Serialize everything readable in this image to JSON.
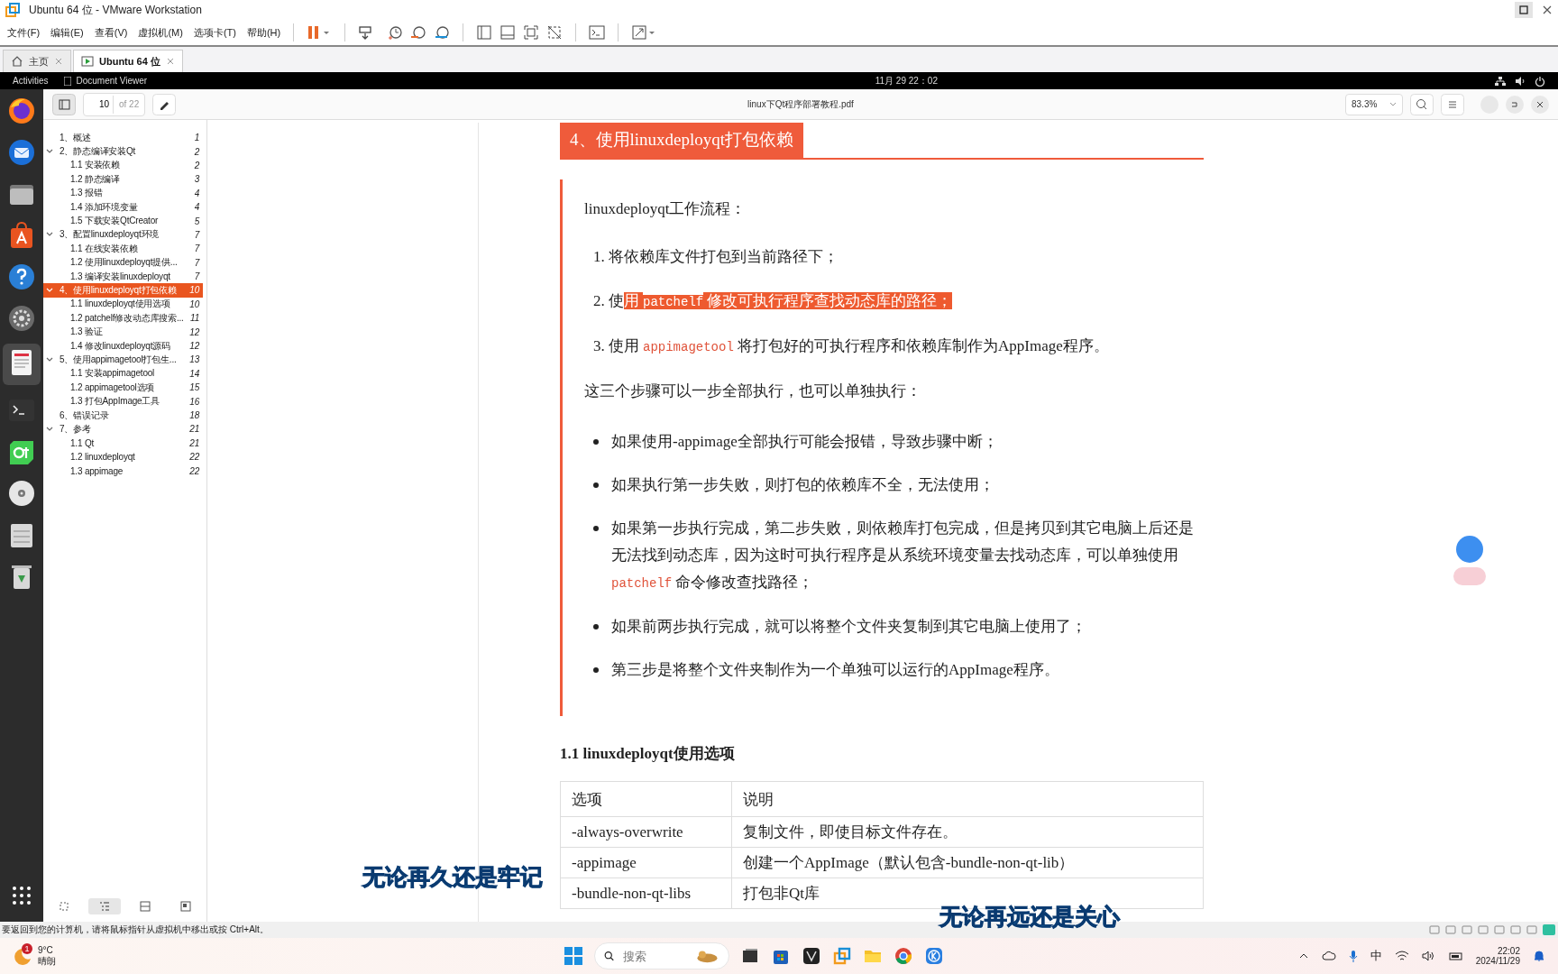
{
  "window": {
    "title": "Ubuntu 64 位 - VMware Workstation"
  },
  "menu": [
    "文件(F)",
    "编辑(E)",
    "查看(V)",
    "虚拟机(M)",
    "选项卡(T)",
    "帮助(H)"
  ],
  "tabs": [
    {
      "label": "主页",
      "kind": "home",
      "selected": false
    },
    {
      "label": "Ubuntu 64 位",
      "kind": "vm",
      "selected": true
    }
  ],
  "topbar": {
    "activities": "Activities",
    "app": "Document Viewer",
    "clock": "11月 29  22：02"
  },
  "viewer": {
    "page": "10",
    "page_count": "of 22",
    "filename": "linux下Qt程序部署教程.pdf",
    "zoom": "83.3%"
  },
  "outline": {
    "items": [
      {
        "title": "1、概述",
        "page": "1",
        "selected": false
      },
      {
        "title": "2、静态编译安装Qt",
        "page": "2",
        "selected": false,
        "expanded": true,
        "children": [
          {
            "title": "1.1 安装依赖",
            "page": "2",
            "selected": false
          },
          {
            "title": "1.2 静态编译",
            "page": "3",
            "selected": false
          },
          {
            "title": "1.3 报错",
            "page": "4",
            "selected": false
          },
          {
            "title": "1.4 添加环境变量",
            "page": "4",
            "selected": false
          },
          {
            "title": "1.5 下载安装QtCreator",
            "page": "5",
            "selected": false
          }
        ]
      },
      {
        "title": "3、配置linuxdeployqt环境",
        "page": "7",
        "selected": false,
        "expanded": true,
        "children": [
          {
            "title": "1.1 在线安装依赖",
            "page": "7",
            "selected": false
          },
          {
            "title": "1.2 使用linuxdeployqt提供...",
            "page": "7",
            "selected": false
          },
          {
            "title": "1.3 编译安装linuxdeployqt",
            "page": "7",
            "selected": false
          }
        ]
      },
      {
        "title": "4、使用linuxdeployqt打包依赖",
        "page": "10",
        "selected": true,
        "expanded": true,
        "children": [
          {
            "title": "1.1 linuxdeployqt使用选项",
            "page": "10",
            "selected": false
          },
          {
            "title": "1.2 patchelf修改动态库搜索...",
            "page": "11",
            "selected": false
          },
          {
            "title": "1.3 验证",
            "page": "12",
            "selected": false
          },
          {
            "title": "1.4 修改linuxdeployqt源码",
            "page": "12",
            "selected": false
          }
        ]
      },
      {
        "title": "5、使用appimagetool打包生...",
        "page": "13",
        "selected": false,
        "expanded": true,
        "children": [
          {
            "title": "1.1 安装appimagetool",
            "page": "14",
            "selected": false
          },
          {
            "title": "1.2 appimagetool选项",
            "page": "15",
            "selected": false
          },
          {
            "title": "1.3 打包AppImage工具",
            "page": "16",
            "selected": false
          }
        ]
      },
      {
        "title": "6、错误记录",
        "page": "18",
        "selected": false
      },
      {
        "title": "7、参考",
        "page": "21",
        "selected": false,
        "expanded": true,
        "children": [
          {
            "title": "1.1 Qt",
            "page": "21",
            "selected": false
          },
          {
            "title": "1.2 linuxdeployqt",
            "page": "22",
            "selected": false
          },
          {
            "title": "1.3 appimage",
            "page": "22",
            "selected": false
          }
        ]
      }
    ]
  },
  "document": {
    "heading": "4、使用linuxdeployqt打包依赖",
    "intro": "linuxdeployqt工作流程：",
    "steps": [
      {
        "number": "1.",
        "parts": [
          {
            "kind": "text",
            "text": "将依赖库文件打包到当前路径下；",
            "highlighted": false
          }
        ]
      },
      {
        "number": "2.",
        "parts": [
          {
            "kind": "text",
            "text": "使",
            "highlighted": false
          },
          {
            "kind": "text",
            "text": "用 ",
            "highlighted": true
          },
          {
            "kind": "code",
            "text": "patchelf",
            "highlighted": true
          },
          {
            "kind": "text",
            "text": " 修改可执行程序查找动态库的路径；",
            "highlighted": true
          }
        ]
      },
      {
        "number": "3.",
        "parts": [
          {
            "kind": "text",
            "text": "使用 ",
            "highlighted": false
          },
          {
            "kind": "code",
            "text": "appimagetool",
            "highlighted": false
          },
          {
            "kind": "text",
            "text": " 将打包好的可执行程序和依赖库制作为AppImage程序。",
            "highlighted": false
          }
        ]
      }
    ],
    "summary": "这三个步骤可以一步全部执行，也可以单独执行：",
    "bullets": [
      {
        "parts": [
          {
            "kind": "text",
            "text": "如果使用-appimage全部执行可能会报错，导致步骤中断；"
          }
        ]
      },
      {
        "parts": [
          {
            "kind": "text",
            "text": "如果执行第一步失败，则打包的依赖库不全，无法使用；"
          }
        ]
      },
      {
        "parts": [
          {
            "kind": "text",
            "text": "如果第一步执行完成，第二步失败，则依赖库打包完成，但是拷贝到其它电脑上后还是无法找到动态库，因为这时可执行程序是从系统环境变量去找动态库，可以单独使用 "
          },
          {
            "kind": "code",
            "text": "patchelf"
          },
          {
            "kind": "text",
            "text": " 命令修改查找路径；"
          }
        ]
      },
      {
        "parts": [
          {
            "kind": "text",
            "text": "如果前两步执行完成，就可以将整个文件夹复制到其它电脑上使用了；"
          }
        ]
      },
      {
        "parts": [
          {
            "kind": "text",
            "text": "第三步是将整个文件夹制作为一个单独可以运行的AppImage程序。"
          }
        ]
      }
    ],
    "subheading": "1.1 linuxdeployqt使用选项",
    "table": {
      "columns": [
        "选项",
        "说明"
      ],
      "rows": [
        [
          "-always-overwrite",
          "复制文件，即使目标文件存在。"
        ],
        [
          "-appimage",
          "创建一个AppImage（默认包含-bundle-non-qt-lib）"
        ],
        [
          "-bundle-non-qt-libs",
          "打包非Qt库"
        ]
      ]
    }
  },
  "subtitles": [
    {
      "text": "无论再久还是牢记",
      "kind": "left"
    },
    {
      "text": "无论再远还是关心",
      "kind": "right"
    }
  ],
  "status_bar": "要返回到您的计算机，请将鼠标指针从虚拟机中移出或按 Ctrl+Alt。",
  "taskbar": {
    "weather_badge": "1",
    "temperature": "9°C",
    "condition": "晴朗",
    "search_placeholder": "搜索",
    "input_method": "中",
    "time": "22:02",
    "date": "2024/11/29"
  }
}
